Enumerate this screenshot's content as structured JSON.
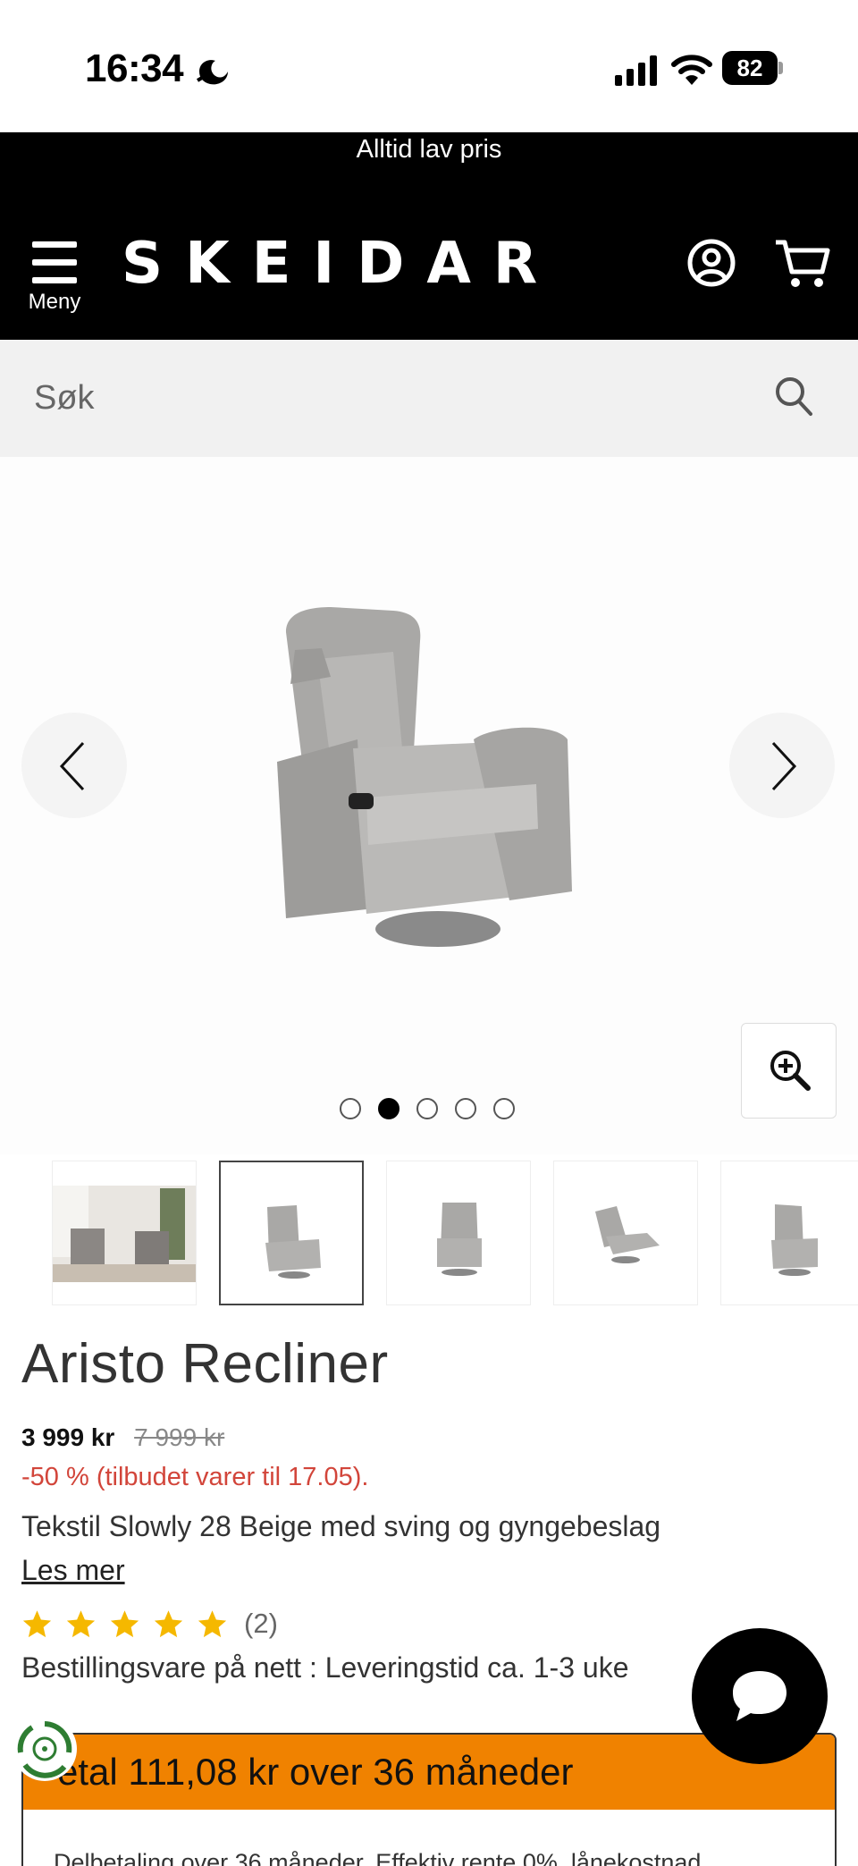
{
  "status_bar": {
    "time": "16:34",
    "battery": "82"
  },
  "header": {
    "promo": "Alltid lav pris",
    "menu_label": "Meny",
    "logo": "SKEIDAR"
  },
  "search": {
    "placeholder": "Søk"
  },
  "gallery": {
    "dot_count": 5,
    "active_dot": 2,
    "thumbnail_count": 5,
    "selected_thumbnail": 2
  },
  "product": {
    "title": "Aristo Recliner",
    "price": "3 999 kr",
    "old_price": "7 999 kr",
    "discount": "-50 % (tilbudet varer til 17.05).",
    "subtitle": "Tekstil Slowly 28 Beige med sving og gyngebeslag",
    "read_more": "Les mer",
    "rating": 5,
    "rating_count": "(2)",
    "delivery": "Bestillingsvare på nett : Leveringstid ca. 1-3 uke"
  },
  "installment": {
    "title": "etal 111,08 kr over 36 måneder",
    "text": "Delbetaling over 36 måneder. Effektiv rente 0%. lånekostnad"
  },
  "colors": {
    "header_bg": "#000000",
    "accent_orange": "#f08200",
    "discount_red": "#d2453a",
    "star_yellow": "#f5b800"
  }
}
